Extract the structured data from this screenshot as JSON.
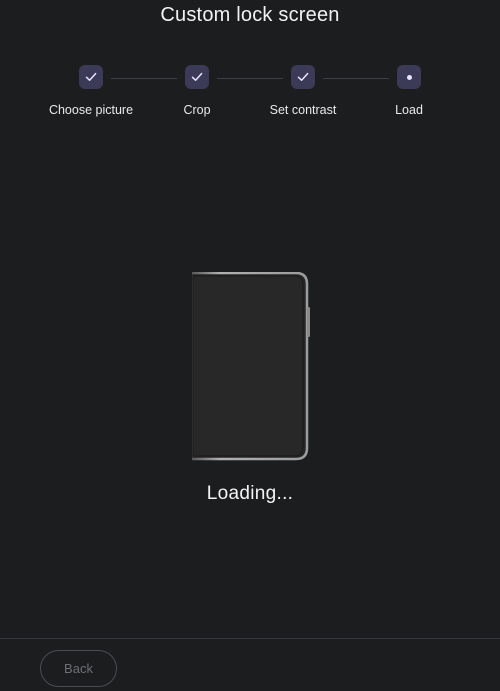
{
  "header": {
    "title": "Custom lock screen"
  },
  "stepper": {
    "steps": [
      {
        "label": "Choose picture",
        "state": "completed"
      },
      {
        "label": "Crop",
        "state": "completed"
      },
      {
        "label": "Set contrast",
        "state": "completed"
      },
      {
        "label": "Load",
        "state": "current"
      }
    ]
  },
  "main": {
    "status_text": "Loading..."
  },
  "footer": {
    "back_label": "Back"
  },
  "colors": {
    "background": "#1c1d1f",
    "step_fill": "#3b3a57",
    "step_accent": "#e6e4ff",
    "connector": "#3e4045",
    "device_screen": "#262626",
    "device_frame": "#9a9a9a"
  },
  "icons": {
    "completed_step": "check-icon",
    "current_step": "dot-icon",
    "illustration": "device-icon"
  }
}
